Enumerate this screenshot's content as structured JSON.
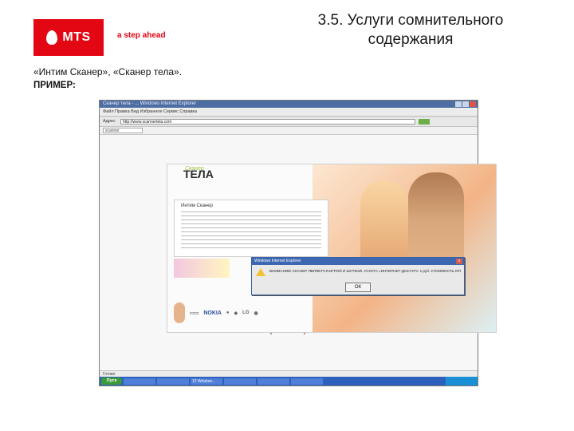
{
  "brand": {
    "logo_text": "MTS",
    "tagline": "a step ahead",
    "color": "#e30613"
  },
  "slide": {
    "title": "3.5. Услуги сомнительного содержания",
    "subtitle": "«Интим Сканер», «Сканер тела».",
    "example_label": "ПРИМЕР:"
  },
  "browser": {
    "window_title": "Сканер тела - ... Windows Internet Explorer",
    "address_label": "Адрес",
    "address": "http://www.scannertela.com",
    "tab_label": "scanner",
    "menu": "Файл  Правка  Вид  Избранное  Сервис  Справка",
    "status": "Готово",
    "taskbar": {
      "start_label": "Пуск",
      "tasks": [
        "",
        "",
        "12 Window...",
        "",
        "",
        "",
        ""
      ]
    }
  },
  "site": {
    "logo": "ТЕЛА",
    "logo_top": "Сканер",
    "panel_title": "Интим Сканер",
    "brands": [
      "NOKIA",
      "LG"
    ]
  },
  "dialog": {
    "title": "Windows Internet Explorer",
    "message": "ВНИМАНИЕ! СКАНЕР ЯВЛЯЕТСЯ ИГРОЙ И ШУТКОЙ. УСЛУГА «ИНТЕРНЕТ-ДОСТУП» 1 руб. СТОИМОСТЬ ОТПРАВКИ SMS",
    "ok_label": "ОК"
  }
}
